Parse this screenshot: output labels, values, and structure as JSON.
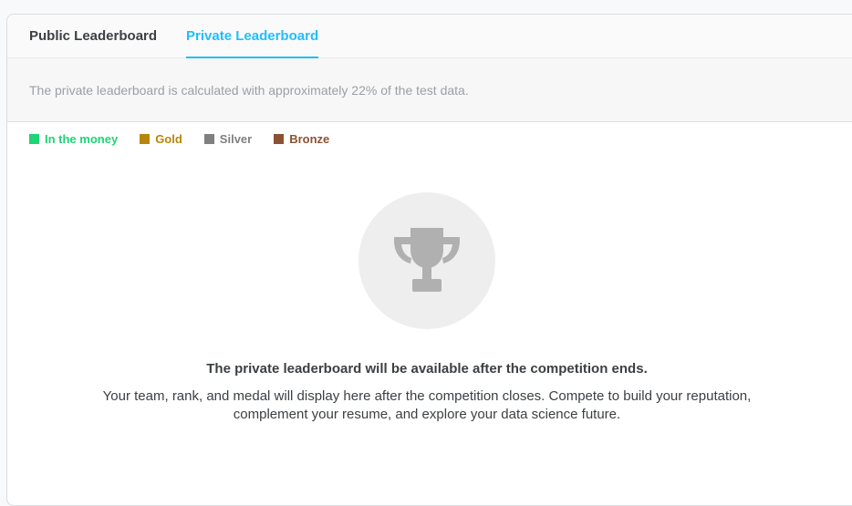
{
  "tabs": [
    {
      "label": "Public Leaderboard",
      "active": false
    },
    {
      "label": "Private Leaderboard",
      "active": true
    }
  ],
  "info": {
    "text": "The private leaderboard is calculated with approximately 22% of the test data."
  },
  "legend": [
    {
      "label": "In the money",
      "color": "#1fd474"
    },
    {
      "label": "Gold",
      "color": "#b8860b"
    },
    {
      "label": "Silver",
      "color": "#808080"
    },
    {
      "label": "Bronze",
      "color": "#8b5232"
    }
  ],
  "empty_state": {
    "icon": "trophy-icon",
    "title": "The private leaderboard will be available after the competition ends.",
    "description": "Your team, rank, and medal will display here after the competition closes. Compete to build your reputation, complement your resume, and explore your data science future."
  },
  "colors": {
    "accent": "#20beff",
    "icon_gray": "#b0b0b0"
  }
}
